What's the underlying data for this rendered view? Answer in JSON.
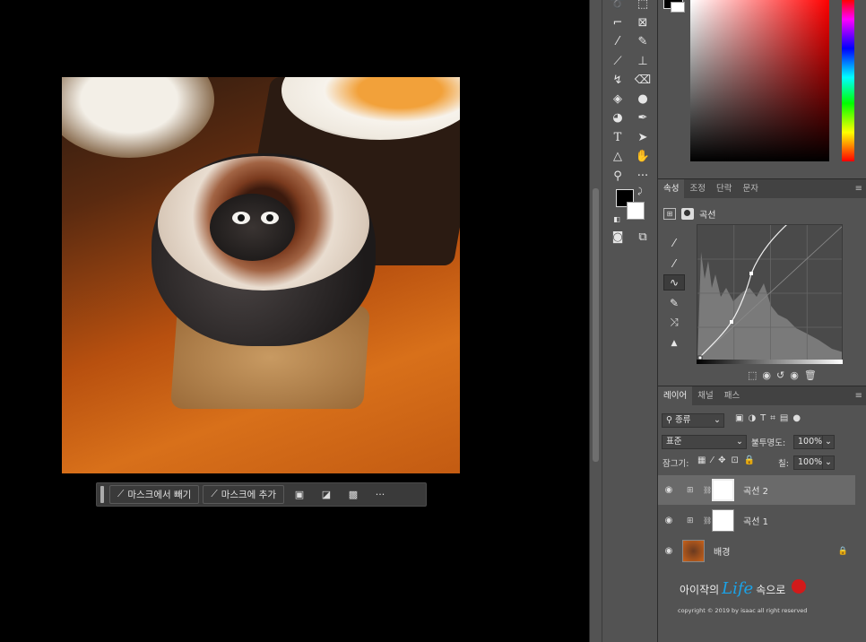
{
  "taskbar": {
    "subtract_label": "마스크에서 빼기",
    "add_label": "마스크에 추가",
    "more_label": "···"
  },
  "properties_panel": {
    "tabs": [
      "속성",
      "조정",
      "단락",
      "문자"
    ],
    "adjustment_title": "곡선"
  },
  "layers_panel": {
    "tabs": [
      "레이어",
      "채널",
      "패스"
    ],
    "filter_kind": "종류",
    "blend_mode": "표준",
    "opacity_label": "불투명도:",
    "opacity_value": "100%",
    "lock_label": "잠그기:",
    "fill_label": "칠:",
    "fill_value": "100%",
    "layers": [
      {
        "name": "곡선 2",
        "selected": true
      },
      {
        "name": "곡선 1",
        "selected": false
      },
      {
        "name": "배경",
        "selected": false,
        "locked": true
      }
    ]
  },
  "watermark": {
    "title_prefix": "아이작의",
    "title_life": "Life",
    "title_suffix": "속으로",
    "copyright": "copyright © 2019 by isaac all right reserved"
  },
  "colors": {
    "foreground": "#000000",
    "background": "#ffffff",
    "panel_bg": "#535353",
    "accent_life": "#1aa3e8"
  }
}
